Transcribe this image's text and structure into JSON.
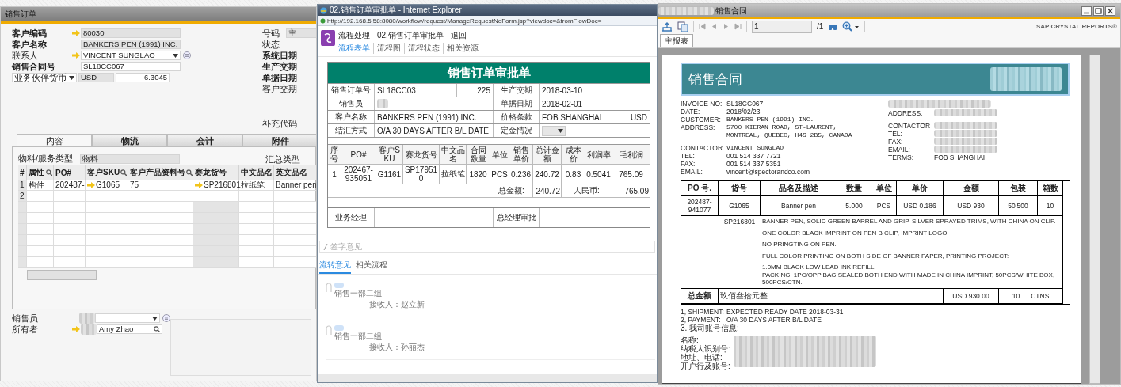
{
  "sales_order_window": {
    "title": "销售订单",
    "fields": [
      {
        "label": "客户编码",
        "bold": true,
        "link_arrow": true,
        "value": "80030",
        "kind": "readonly",
        "list_button": false
      },
      {
        "label": "客户名称",
        "bold": true,
        "link_arrow": false,
        "value": "BANKERS PEN (1991) INC.",
        "kind": "readonly",
        "list_button": false
      },
      {
        "label": "联系人",
        "bold": false,
        "link_arrow": true,
        "value": "VINCENT SUNGLAO",
        "kind": "dropdown",
        "list_button": true
      },
      {
        "label": "销售合同号",
        "bold": true,
        "link_arrow": false,
        "value": "SL18CC067",
        "kind": "text",
        "list_button": false
      }
    ],
    "currency_row": {
      "selector": "业务伙伴货币",
      "currency": "USD",
      "rate": "6.3045"
    },
    "right_fields": [
      {
        "label": "号码",
        "bold": false,
        "value": "主"
      },
      {
        "label": "状态",
        "bold": false
      },
      {
        "label": "系统日期",
        "bold": true
      },
      {
        "label": "生产交期",
        "bold": true
      },
      {
        "label": "单据日期",
        "bold": true
      },
      {
        "label": "客户交期",
        "bold": false
      }
    ],
    "extra_field": {
      "label": "补充代码"
    },
    "tabs": [
      {
        "label": "内容",
        "selected": true
      },
      {
        "label": "物流",
        "selected": false
      },
      {
        "label": "会计",
        "selected": false
      },
      {
        "label": "附件",
        "selected": false
      }
    ],
    "item_type": {
      "label": "物料/服务类型",
      "value": "物料"
    },
    "summary_type": {
      "label": "汇总类型"
    },
    "table": {
      "columns": [
        {
          "label": "#",
          "search": false,
          "readonly": false
        },
        {
          "label": "属性",
          "search": true,
          "readonly": false
        },
        {
          "label": "PO#",
          "search": false,
          "readonly": false
        },
        {
          "label": "客户SKU",
          "search": true,
          "readonly": false
        },
        {
          "label": "客户产品资料号",
          "search": true,
          "readonly": false
        },
        {
          "label": "赛龙货号",
          "search": false,
          "readonly": true
        },
        {
          "label": "中文品名",
          "search": false,
          "readonly": false
        },
        {
          "label": "英文品名",
          "search": false,
          "readonly": false
        }
      ],
      "rows": [
        {
          "cells": [
            {
              "text": "1",
              "link_arrow": false
            },
            {
              "text": "构件",
              "link_arrow": false
            },
            {
              "text": "202487-",
              "link_arrow": false
            },
            {
              "text": "G1065",
              "link_arrow": true
            },
            {
              "text": "75",
              "link_arrow": false
            },
            {
              "text": "SP216801",
              "link_arrow": true
            },
            {
              "text": "拉纸笔",
              "link_arrow": false
            },
            {
              "text": "Banner pen",
              "link_arrow": false
            }
          ]
        },
        {
          "cells": [
            {
              "text": "2",
              "link_arrow": false
            }
          ]
        }
      ]
    },
    "bottom_fields": [
      {
        "label": "销售员",
        "redacted": true,
        "link_arrow": false,
        "kind": "dropdown",
        "list_button": true
      },
      {
        "label": "所有者",
        "redacted": true,
        "link_arrow": true,
        "kind": "search",
        "value": "Amy Zhao",
        "list_button": false
      }
    ]
  },
  "approval_window": {
    "title": "02.销售订单审批单 - Internet Explorer",
    "url": "http://192.168.5.58:8080/workflow/request/ManageRequestNoForm.jsp?viewdoc=&fromFlowDoc=",
    "page_title": "流程处理 - 02.销售订单审批单 - 退回",
    "nav": [
      {
        "label": "流程表单",
        "selected": true
      },
      {
        "label": "流程图",
        "selected": false
      },
      {
        "label": "流程状态",
        "selected": false
      },
      {
        "label": "相关资源",
        "selected": false
      }
    ],
    "form_title": "销售订单审批单",
    "header_rows": [
      {
        "left": {
          "label": "销售订单号",
          "kind": "text",
          "value": "SL18CC03",
          "extra": "225"
        },
        "right": {
          "label": "生产交期",
          "kind": "text",
          "value": "2018-03-10"
        }
      },
      {
        "left": {
          "label": "销售员",
          "kind": "redacted"
        },
        "right": {
          "label": "单据日期",
          "kind": "text",
          "value": "2018-02-01"
        }
      },
      {
        "left": {
          "label": "客户名称",
          "kind": "text",
          "value": "BANKERS PEN (1991) INC."
        },
        "right": {
          "label": "价格条款",
          "kind": "text",
          "value": "FOB SHANGHAI",
          "extra": "USD"
        }
      },
      {
        "left": {
          "label": "结汇方式",
          "kind": "text",
          "value": "O/A 30 DAYS AFTER B/L DATE"
        },
        "right": {
          "label": "定金情况",
          "kind": "select"
        }
      }
    ],
    "items": {
      "columns": [
        "序号",
        "PO#",
        "客户SKU",
        "赛龙货号",
        "中文品名",
        "合同数量",
        "单位",
        "销售单价",
        "总计金额",
        "成本价",
        "利润率",
        "毛利润"
      ],
      "rows": [
        [
          "1",
          "202467-935051",
          "G1161",
          "SP179510",
          "拉纸笔",
          "1820",
          "PCS",
          "0.236",
          "240.72",
          "0.83",
          "0.5041",
          "765.09"
        ]
      ],
      "totals": [
        {
          "label": "总金额:",
          "value": "240.72"
        },
        {
          "label": "人民币:",
          "value": "765.09"
        }
      ]
    },
    "approvals": [
      {
        "label": "业务经理"
      },
      {
        "label": "总经理审批"
      }
    ],
    "comment_placeholder": "签字意见",
    "log_tabs": [
      {
        "label": "流转意见",
        "selected": true
      },
      {
        "label": "相关流程",
        "selected": false
      }
    ],
    "log_entries": [
      {
        "department": "销售一部二组",
        "receiver": "接收人：赵立新"
      },
      {
        "department": "销售一部二组",
        "receiver": "接收人：孙丽杰"
      }
    ]
  },
  "report_window": {
    "title": "销售合同",
    "page": "1",
    "page_total": "/1",
    "brand": "SAP CRYSTAL REPORTS®",
    "tabs": [
      {
        "label": "主报表",
        "selected": true
      }
    ],
    "document": {
      "heading": "销售合同",
      "left_info": [
        [
          {
            "label": "INVOICE NO:",
            "values": [
              "SL18CC067"
            ],
            "typewriter": false
          },
          {
            "label": "DATE:",
            "values": [
              "2018/02/23"
            ],
            "typewriter": false
          },
          {
            "label": "CUSTOMER:",
            "values": [
              "BANKERS PEN (1991) INC."
            ],
            "typewriter": true
          },
          {
            "label": "ADDRESS:",
            "values": [
              "5700 KIERAN ROAD, ST-LAURENT,",
              "MONTREAL, QUEBEC, H4S 2B5, CANADA"
            ],
            "typewriter": true
          }
        ],
        [
          {
            "label": "CONTACTOR",
            "values": [
              "VINCENT SUNGLAO"
            ],
            "typewriter": true
          },
          {
            "label": "TEL:",
            "values": [
              "001 514 337 7721"
            ],
            "typewriter": false
          },
          {
            "label": "FAX:",
            "values": [
              "001 514 337 5351"
            ],
            "typewriter": false
          },
          {
            "label": "EMAIL:",
            "values": [
              "vincent@spectorandco.com"
            ],
            "typewriter": false
          }
        ]
      ],
      "right_info": [
        [
          {
            "redacted": true
          },
          {
            "label": "ADDRESS:",
            "redacted": true
          }
        ],
        [
          {
            "label": "CONTACTOR",
            "redacted": true
          },
          {
            "label": "TEL:",
            "redacted": true
          },
          {
            "label": "FAX:",
            "redacted": true
          },
          {
            "label": "EMAIL:",
            "redacted": true
          },
          {
            "label": "TERMS:",
            "value": "FOB SHANGHAI",
            "redacted": false
          }
        ]
      ],
      "columns": [
        "PO 号.",
        "货号",
        "品名及描述",
        "数量",
        "单位",
        "单价",
        "金额",
        "包装",
        "箱数"
      ],
      "row": [
        "202487-941077",
        "G1065",
        "Banner pen",
        "5.000",
        "PCS",
        "USD  0.186",
        "USD 930",
        "50'500",
        "10"
      ],
      "item_code": "SP216801",
      "description": [
        [
          "BANNER PEN, SOLID GREEN BARREL AND GRIP, SILVER SPRAYED TRIMS, WITH CHINA ON CLIP."
        ],
        [
          "ONE COLOR BLACK IMPRINT ON PEN B CLIP, IMPRINT LOGO:"
        ],
        [
          "NO PRINGTING ON PEN."
        ],
        [
          "FULL COLOR PRINTING ON BOTH SIDE OF BANNER PAPER, PRINTING PROJECT:"
        ],
        [
          "1.0MM BLACK LOW LEAD INK REFILL",
          "PACKING: 1PC/OPP BAG SEALED BOTH END WITH MADE IN CHINA IMPRINT, 50PCS/WHITE BOX, 500PCS/CTN."
        ]
      ],
      "total": {
        "label": "总金额",
        "words": "玖佰叁拾元整",
        "amount": "USD 930.00",
        "cartons": "10",
        "unit": "CTNS"
      },
      "terms": [
        {
          "label": "1, SHIPMENT:",
          "value": "EXPECTED READY DATE 2018-03-31"
        },
        {
          "label": "2, PAYMENT:",
          "value": "O/A 30 DAYS AFTER B/L DATE"
        },
        {
          "label": "3. 我司账号信息:"
        }
      ],
      "bank": [
        {
          "label": "名称:"
        },
        {
          "label": "纳税人识别号:"
        },
        {
          "label": "地址、电话:"
        },
        {
          "label": "开户行及账号:"
        }
      ]
    }
  }
}
